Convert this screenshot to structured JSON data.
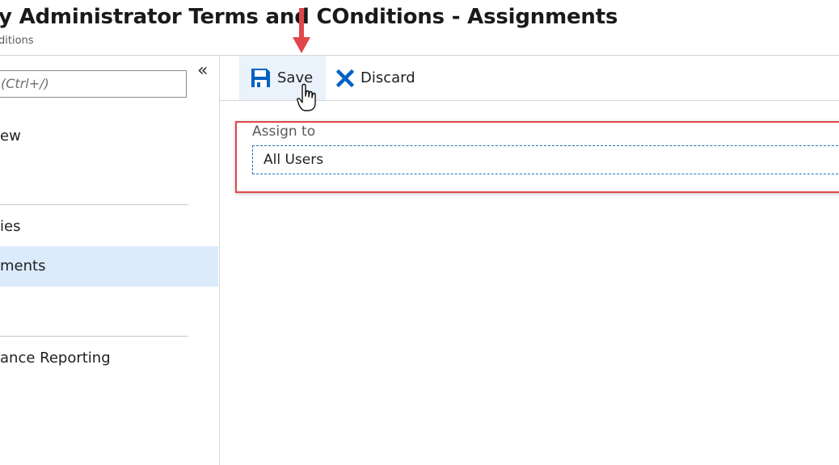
{
  "header": {
    "title": "y Administrator Terms and COnditions - Assignments",
    "subtitle": "ditions"
  },
  "sidebar": {
    "search_placeholder": "(Ctrl+/)",
    "collapse_icon": "«",
    "items": [
      {
        "label": "ew",
        "active": false
      },
      {
        "label": "ies",
        "active": false
      },
      {
        "label": "ments",
        "active": true
      },
      {
        "label": "ance Reporting",
        "active": false
      }
    ]
  },
  "toolbar": {
    "save_label": "Save",
    "discard_label": "Discard"
  },
  "form": {
    "assign_label": "Assign to",
    "assign_value": "All Users"
  },
  "colors": {
    "accent": "#0062c3",
    "highlight_border": "#e0474c",
    "active_nav": "#dcebfc"
  }
}
